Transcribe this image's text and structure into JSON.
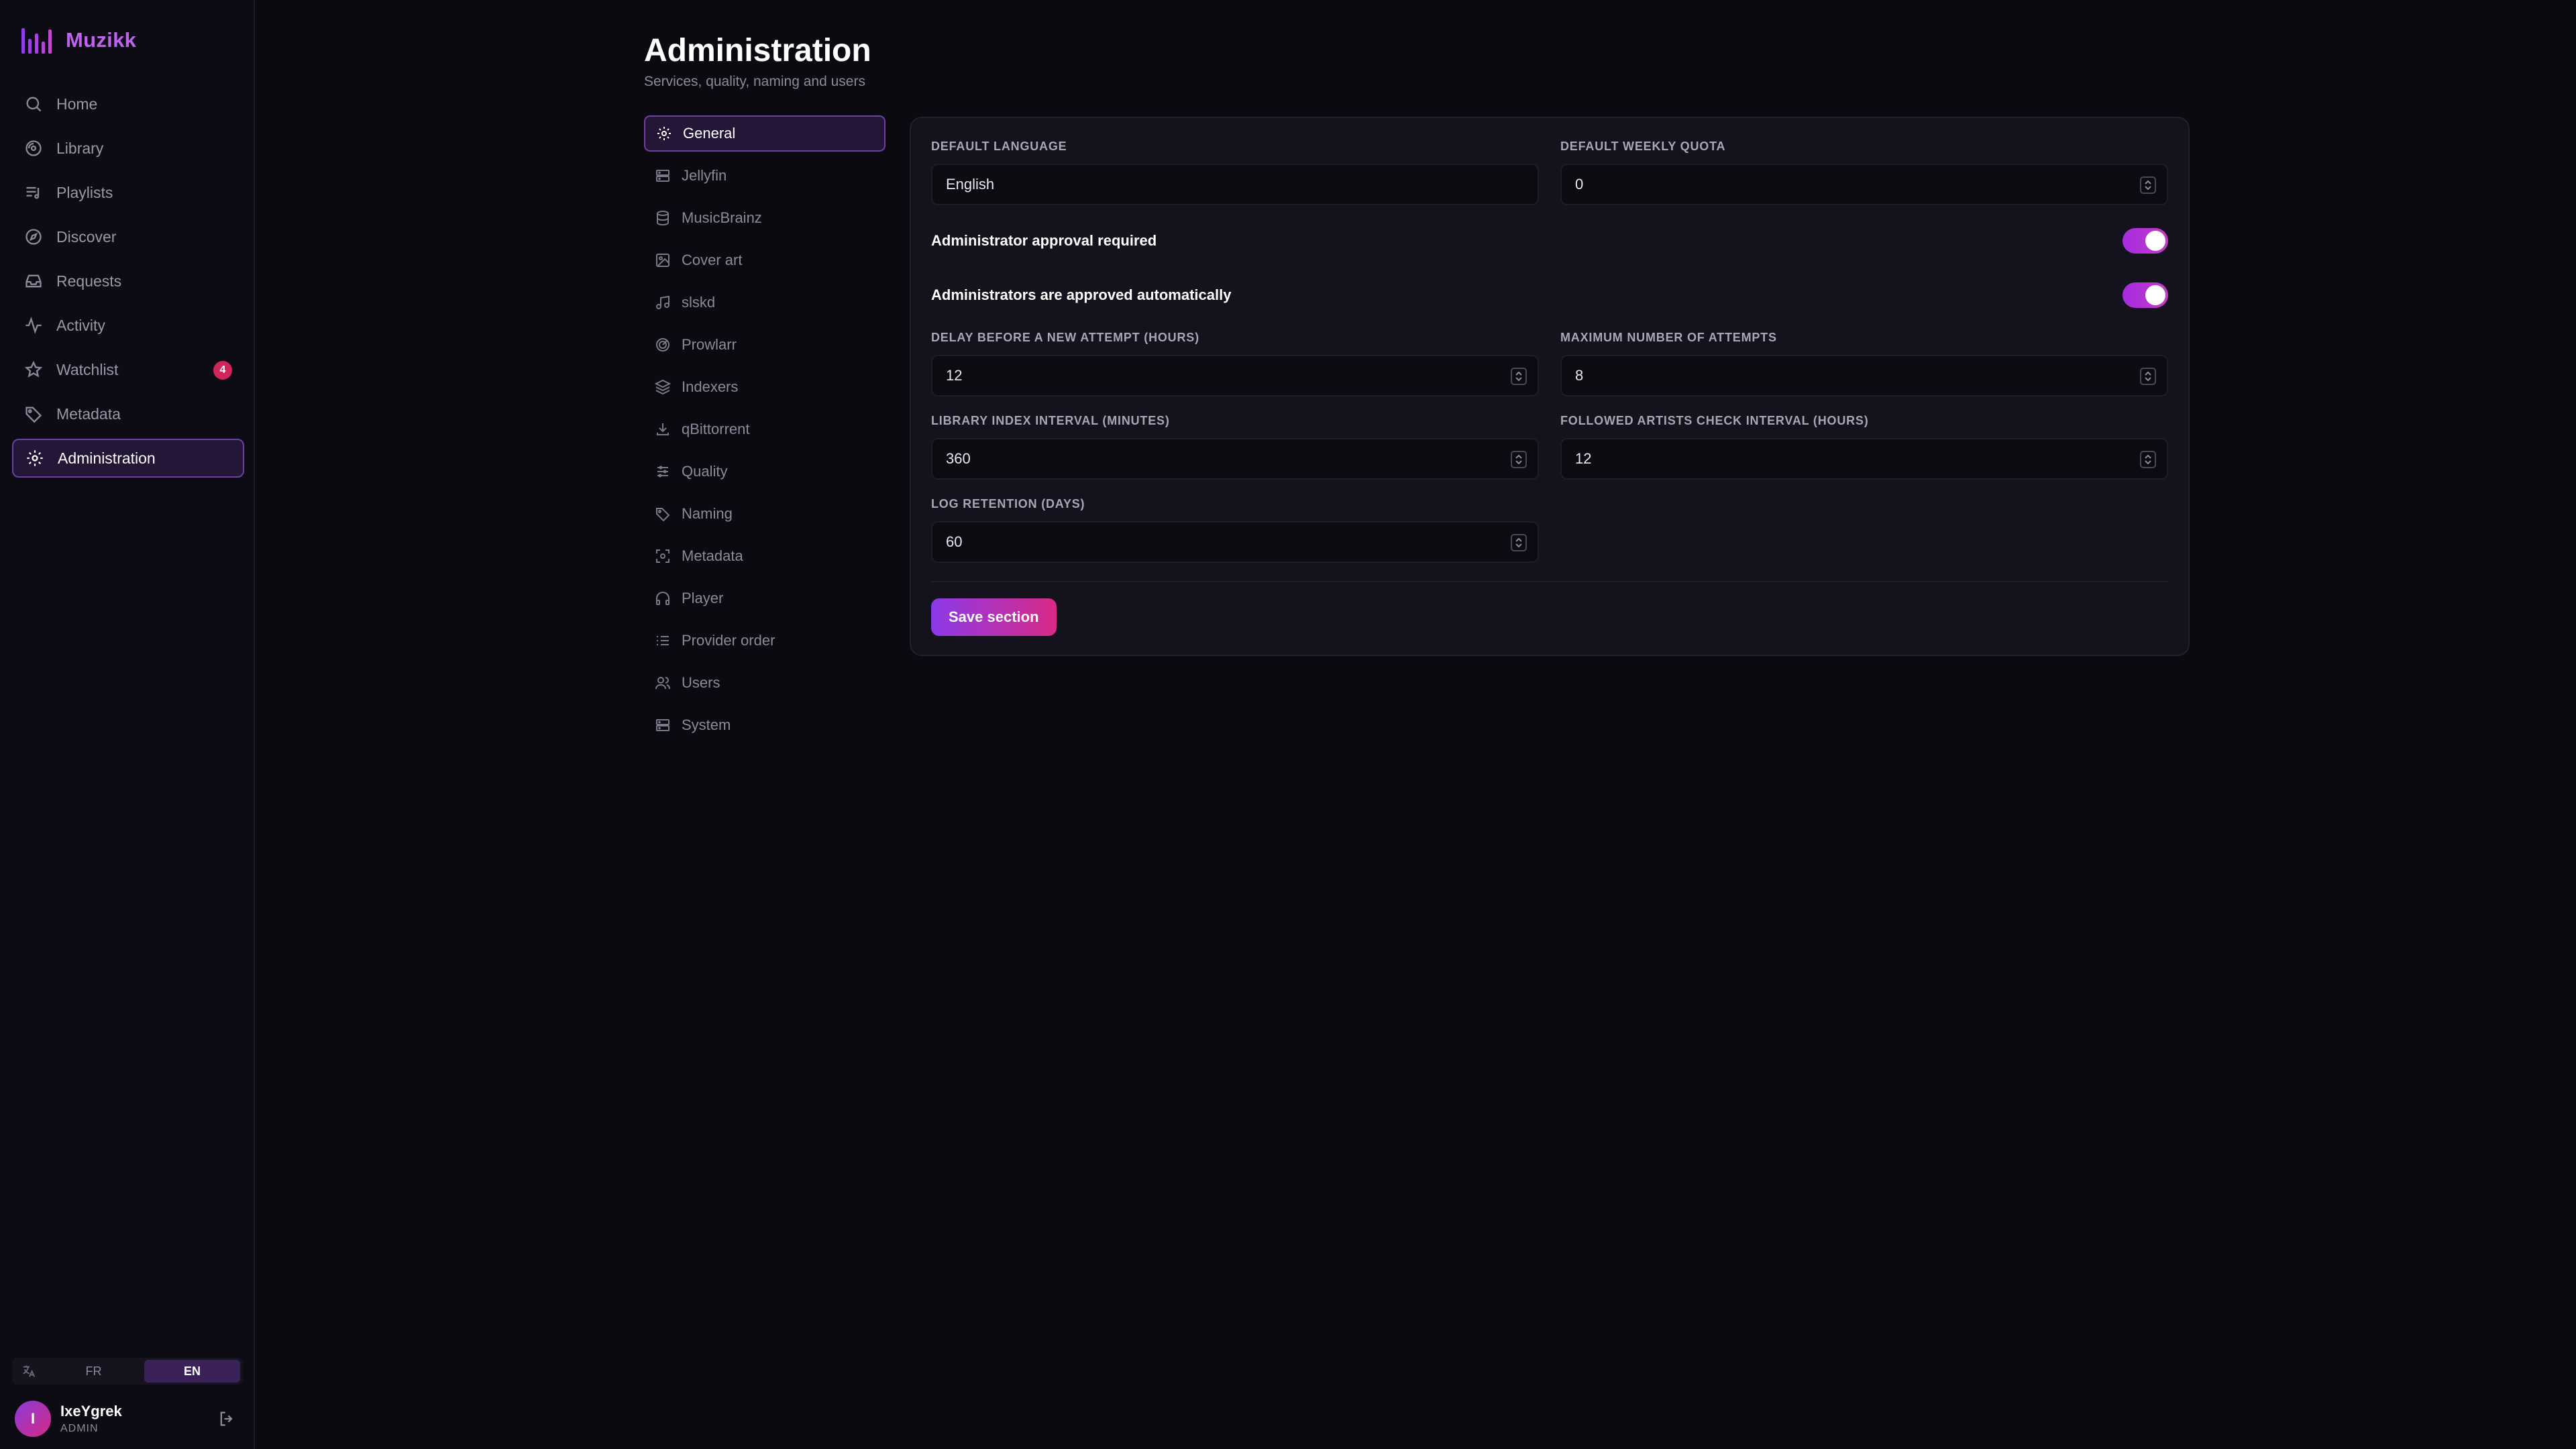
{
  "app": {
    "name": "Muzikk"
  },
  "sidebar": {
    "items": [
      {
        "label": "Home",
        "icon": "search-icon"
      },
      {
        "label": "Library",
        "icon": "disc-icon"
      },
      {
        "label": "Playlists",
        "icon": "playlist-icon"
      },
      {
        "label": "Discover",
        "icon": "compass-icon"
      },
      {
        "label": "Requests",
        "icon": "inbox-icon"
      },
      {
        "label": "Activity",
        "icon": "activity-icon"
      },
      {
        "label": "Watchlist",
        "icon": "star-icon",
        "badge": "4"
      },
      {
        "label": "Metadata",
        "icon": "tag-icon"
      },
      {
        "label": "Administration",
        "icon": "gear-icon",
        "active": true
      }
    ],
    "languages": {
      "options": [
        "FR",
        "EN"
      ],
      "selected": "EN"
    },
    "user": {
      "initial": "I",
      "name": "IxeYgrek",
      "role": "ADMIN"
    }
  },
  "page": {
    "title": "Administration",
    "subtitle": "Services, quality, naming and users"
  },
  "subnav": {
    "items": [
      {
        "label": "General",
        "icon": "gear-icon",
        "active": true
      },
      {
        "label": "Jellyfin",
        "icon": "server-icon"
      },
      {
        "label": "MusicBrainz",
        "icon": "database-icon"
      },
      {
        "label": "Cover art",
        "icon": "image-icon"
      },
      {
        "label": "slskd",
        "icon": "music-note-icon"
      },
      {
        "label": "Prowlarr",
        "icon": "radar-icon"
      },
      {
        "label": "Indexers",
        "icon": "layers-icon"
      },
      {
        "label": "qBittorrent",
        "icon": "download-icon"
      },
      {
        "label": "Quality",
        "icon": "sliders-icon"
      },
      {
        "label": "Naming",
        "icon": "tag-icon"
      },
      {
        "label": "Metadata",
        "icon": "scan-icon"
      },
      {
        "label": "Player",
        "icon": "headphones-icon"
      },
      {
        "label": "Provider order",
        "icon": "list-ordered-icon"
      },
      {
        "label": "Users",
        "icon": "users-icon"
      },
      {
        "label": "System",
        "icon": "server-icon"
      }
    ]
  },
  "general": {
    "default_language": {
      "label": "Default language",
      "value": "English"
    },
    "default_weekly_quota": {
      "label": "Default weekly quota",
      "value": "0"
    },
    "approval_required": {
      "label": "Administrator approval required",
      "enabled": true
    },
    "admins_auto_approved": {
      "label": "Administrators are approved automatically",
      "enabled": true
    },
    "retry_delay": {
      "label": "Delay before a new attempt (hours)",
      "value": "12"
    },
    "max_attempts": {
      "label": "Maximum number of attempts",
      "value": "8"
    },
    "library_index_interval": {
      "label": "Library index interval (minutes)",
      "value": "360"
    },
    "followed_artists_interval": {
      "label": "Followed artists check interval (hours)",
      "value": "12"
    },
    "log_retention": {
      "label": "Log retention (days)",
      "value": "60"
    },
    "save_label": "Save section"
  },
  "colors": {
    "accent": "#a52ce0",
    "accent_pink": "#d92a86",
    "badge": "#d0265c",
    "background": "#0b0a11"
  }
}
